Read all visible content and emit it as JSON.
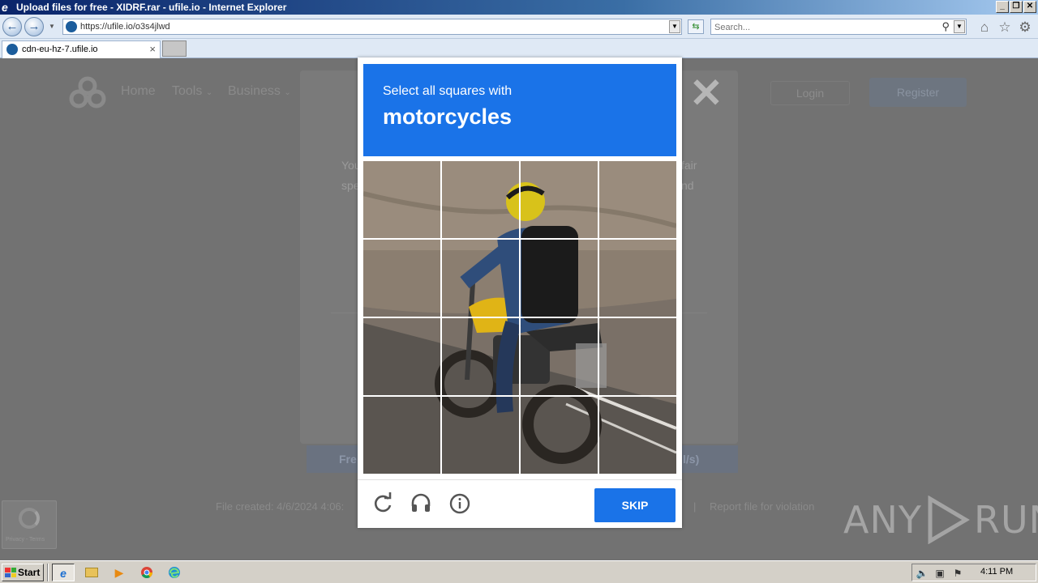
{
  "window": {
    "title": "Upload files for free - XIDRF.rar - ufile.io - Internet Explorer",
    "controls": [
      "minimize",
      "restore",
      "close"
    ]
  },
  "navbar": {
    "address": "https://ufile.io/o3s4jlwd",
    "search_placeholder": "Search...",
    "icons": [
      "back-icon",
      "forward-icon",
      "refresh-go-icon",
      "home-icon",
      "favorites-star-icon",
      "tools-gear-icon"
    ]
  },
  "tabs": [
    {
      "label": "cdn-eu-hz-7.ufile.io"
    }
  ],
  "site": {
    "nav": [
      "Home",
      "Tools",
      "Business"
    ],
    "login": "Login",
    "register": "Register",
    "modal_text_left": [
      "You",
      "spe"
    ],
    "modal_text_right": [
      "fair",
      "nd"
    ],
    "btn_left": "Fre",
    "btn_right": "l/s)",
    "file_created": "File created: 4/6/2024 4:06:",
    "separator": "|",
    "report": "Report file for violation",
    "recaptcha_badge_text": "Privacy - Terms"
  },
  "captcha": {
    "instruction": "Select all squares with",
    "object": "motorcycles",
    "grid_size": 4,
    "skip_label": "SKIP",
    "footer_icons": [
      "reload-icon",
      "audio-challenge-icon",
      "info-icon"
    ],
    "header_color": "#1a73e8"
  },
  "watermark": {
    "left": "ANY",
    "right": "RUN"
  },
  "taskbar": {
    "start_label": "Start",
    "apps": [
      "internet-explorer",
      "file-explorer",
      "media-player",
      "chrome",
      "edge"
    ],
    "clock": "4:11 PM"
  }
}
